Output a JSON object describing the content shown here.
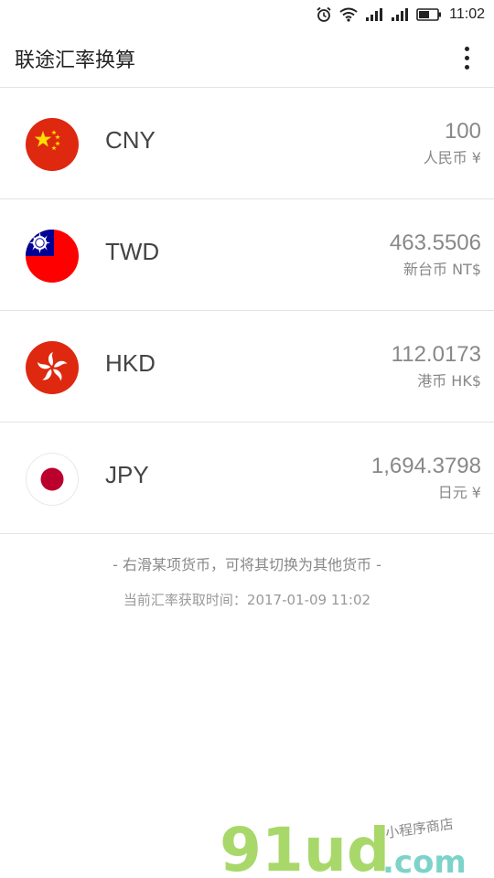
{
  "status_bar": {
    "time": "11:02",
    "icons": [
      "alarm-icon",
      "wifi-icon",
      "signal-icon",
      "signal-icon",
      "battery-icon"
    ]
  },
  "app_bar": {
    "title": "联途汇率换算",
    "menu_icon": "more-vert-icon"
  },
  "currencies": [
    {
      "code": "CNY",
      "amount": "100",
      "name": "人民币 ¥",
      "flag_icon": "china-flag-icon"
    },
    {
      "code": "TWD",
      "amount": "463.5506",
      "name": "新台币 NT$",
      "flag_icon": "taiwan-flag-icon"
    },
    {
      "code": "HKD",
      "amount": "112.0173",
      "name": "港币 HK$",
      "flag_icon": "hong-kong-flag-icon"
    },
    {
      "code": "JPY",
      "amount": "1,694.3798",
      "name": "日元 ¥",
      "flag_icon": "japan-flag-icon"
    }
  ],
  "footer": {
    "hint": "- 右滑某项货币，可将其切换为其他货币 -",
    "fetch_time": "当前汇率获取时间：2017-01-09 11:02"
  },
  "watermark": {
    "brand": "91ud",
    "domain": ".com",
    "tagline": "小程序商店"
  },
  "colors": {
    "china_red": "#de2910",
    "china_yellow": "#ffde00",
    "taiwan_blue": "#000095",
    "hk_red": "#de2910",
    "japan_red": "#bc002d",
    "watermark_green": "#a8d86a",
    "watermark_teal": "#7ed3c9"
  }
}
